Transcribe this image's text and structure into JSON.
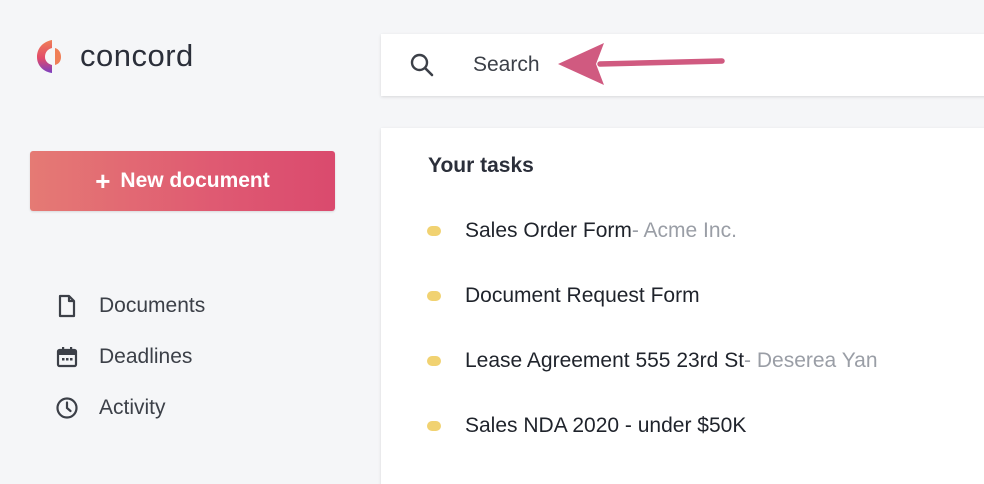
{
  "brand": {
    "name": "concord",
    "logo_icon": "concord-logo-icon",
    "colors": {
      "accent_start": "#e57a74",
      "accent_end": "#da4a6e",
      "task_dot": "#f1d271",
      "annotation_arrow": "#d05a80"
    }
  },
  "sidebar": {
    "new_document": {
      "icon": "plus-icon",
      "label": "New document"
    },
    "items": [
      {
        "icon": "document-icon",
        "label": "Documents"
      },
      {
        "icon": "calendar-icon",
        "label": "Deadlines"
      },
      {
        "icon": "clock-icon",
        "label": "Activity"
      }
    ]
  },
  "search": {
    "icon": "search-icon",
    "placeholder": "Search"
  },
  "tasks": {
    "title": "Your tasks",
    "items": [
      {
        "name": "Sales Order Form",
        "company": " - Acme Inc."
      },
      {
        "name": "Document Request Form",
        "company": ""
      },
      {
        "name": "Lease Agreement 555 23rd St",
        "company": " - Deserea Yan"
      },
      {
        "name": "Sales NDA 2020 - under $50K",
        "company": ""
      }
    ]
  }
}
